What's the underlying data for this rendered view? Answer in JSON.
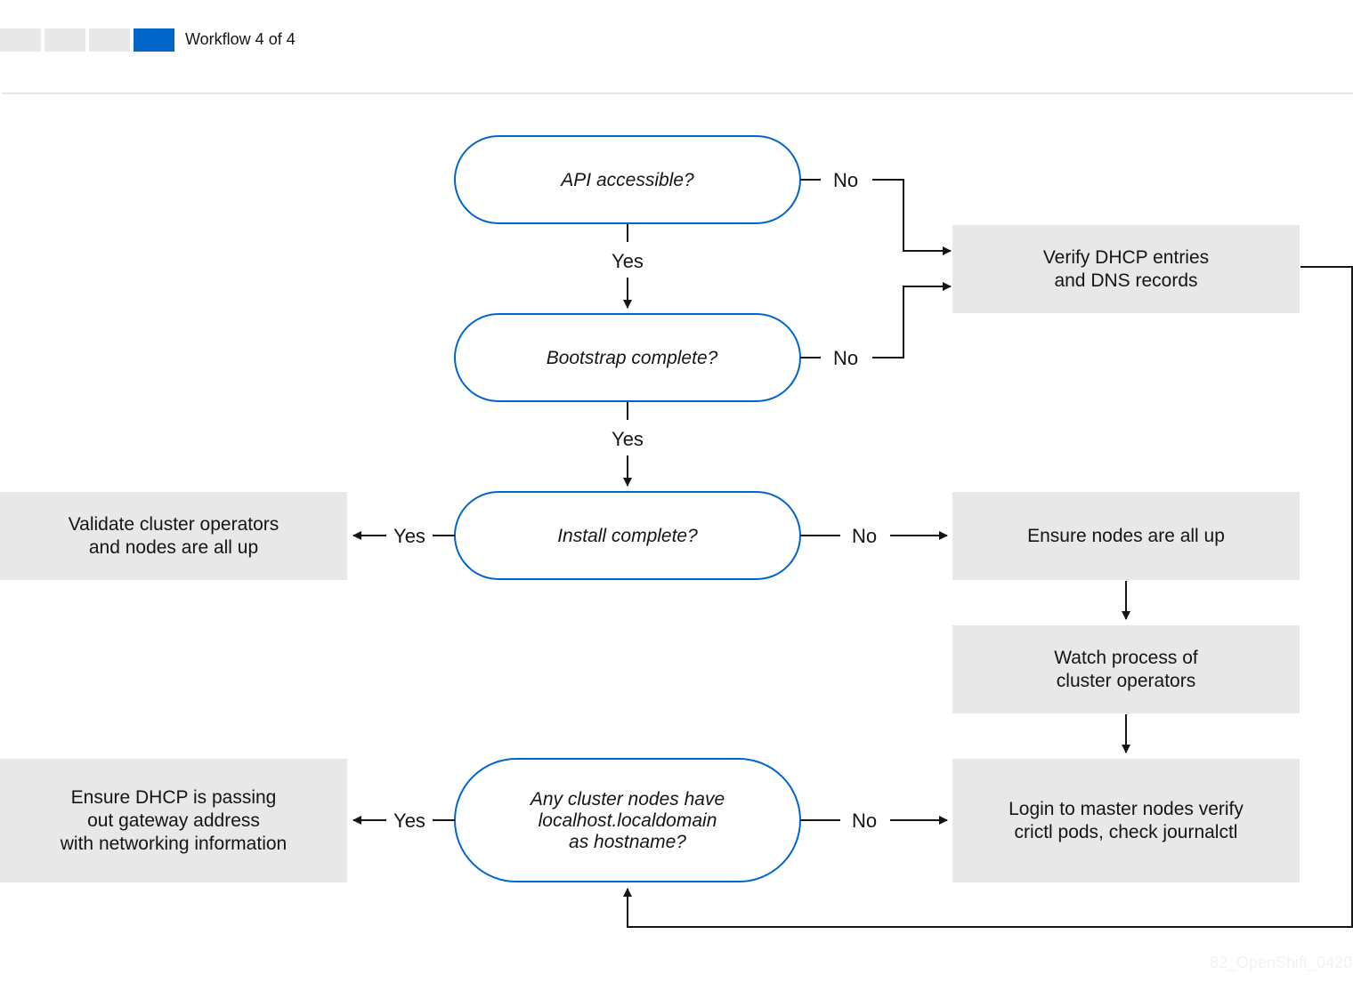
{
  "header": {
    "progress": {
      "current": 4,
      "total": 4
    },
    "label": "Workflow 4 of 4"
  },
  "colors": {
    "accent": "#0066cc",
    "box_fill": "#e8e8e8",
    "line": "#151515"
  },
  "decisions": {
    "api": [
      "API accessible?"
    ],
    "bootstrap": [
      "Bootstrap complete?"
    ],
    "install": [
      "Install complete?"
    ],
    "hostname": [
      "Any cluster nodes have",
      "localhost.localdomain",
      "as hostname?"
    ]
  },
  "actions": {
    "verify_dhcp": [
      "Verify DHCP entries",
      "and DNS records"
    ],
    "validate": [
      "Validate cluster operators",
      "and nodes are all up"
    ],
    "ensure_nodes": [
      "Ensure nodes are all up"
    ],
    "watch": [
      "Watch process of",
      "cluster operators"
    ],
    "login": [
      "Login to master nodes verify",
      "crictl pods, check journalctl"
    ],
    "ensure_dhcp": [
      "Ensure DHCP is passing",
      "out gateway address",
      "with networking information"
    ]
  },
  "edge_labels": {
    "api_no": "No",
    "api_yes": "Yes",
    "bootstrap_no": "No",
    "bootstrap_yes": "Yes",
    "install_yes": "Yes",
    "install_no": "No",
    "hostname_yes": "Yes",
    "hostname_no": "No"
  },
  "watermark": "82_OpenShift_0420"
}
